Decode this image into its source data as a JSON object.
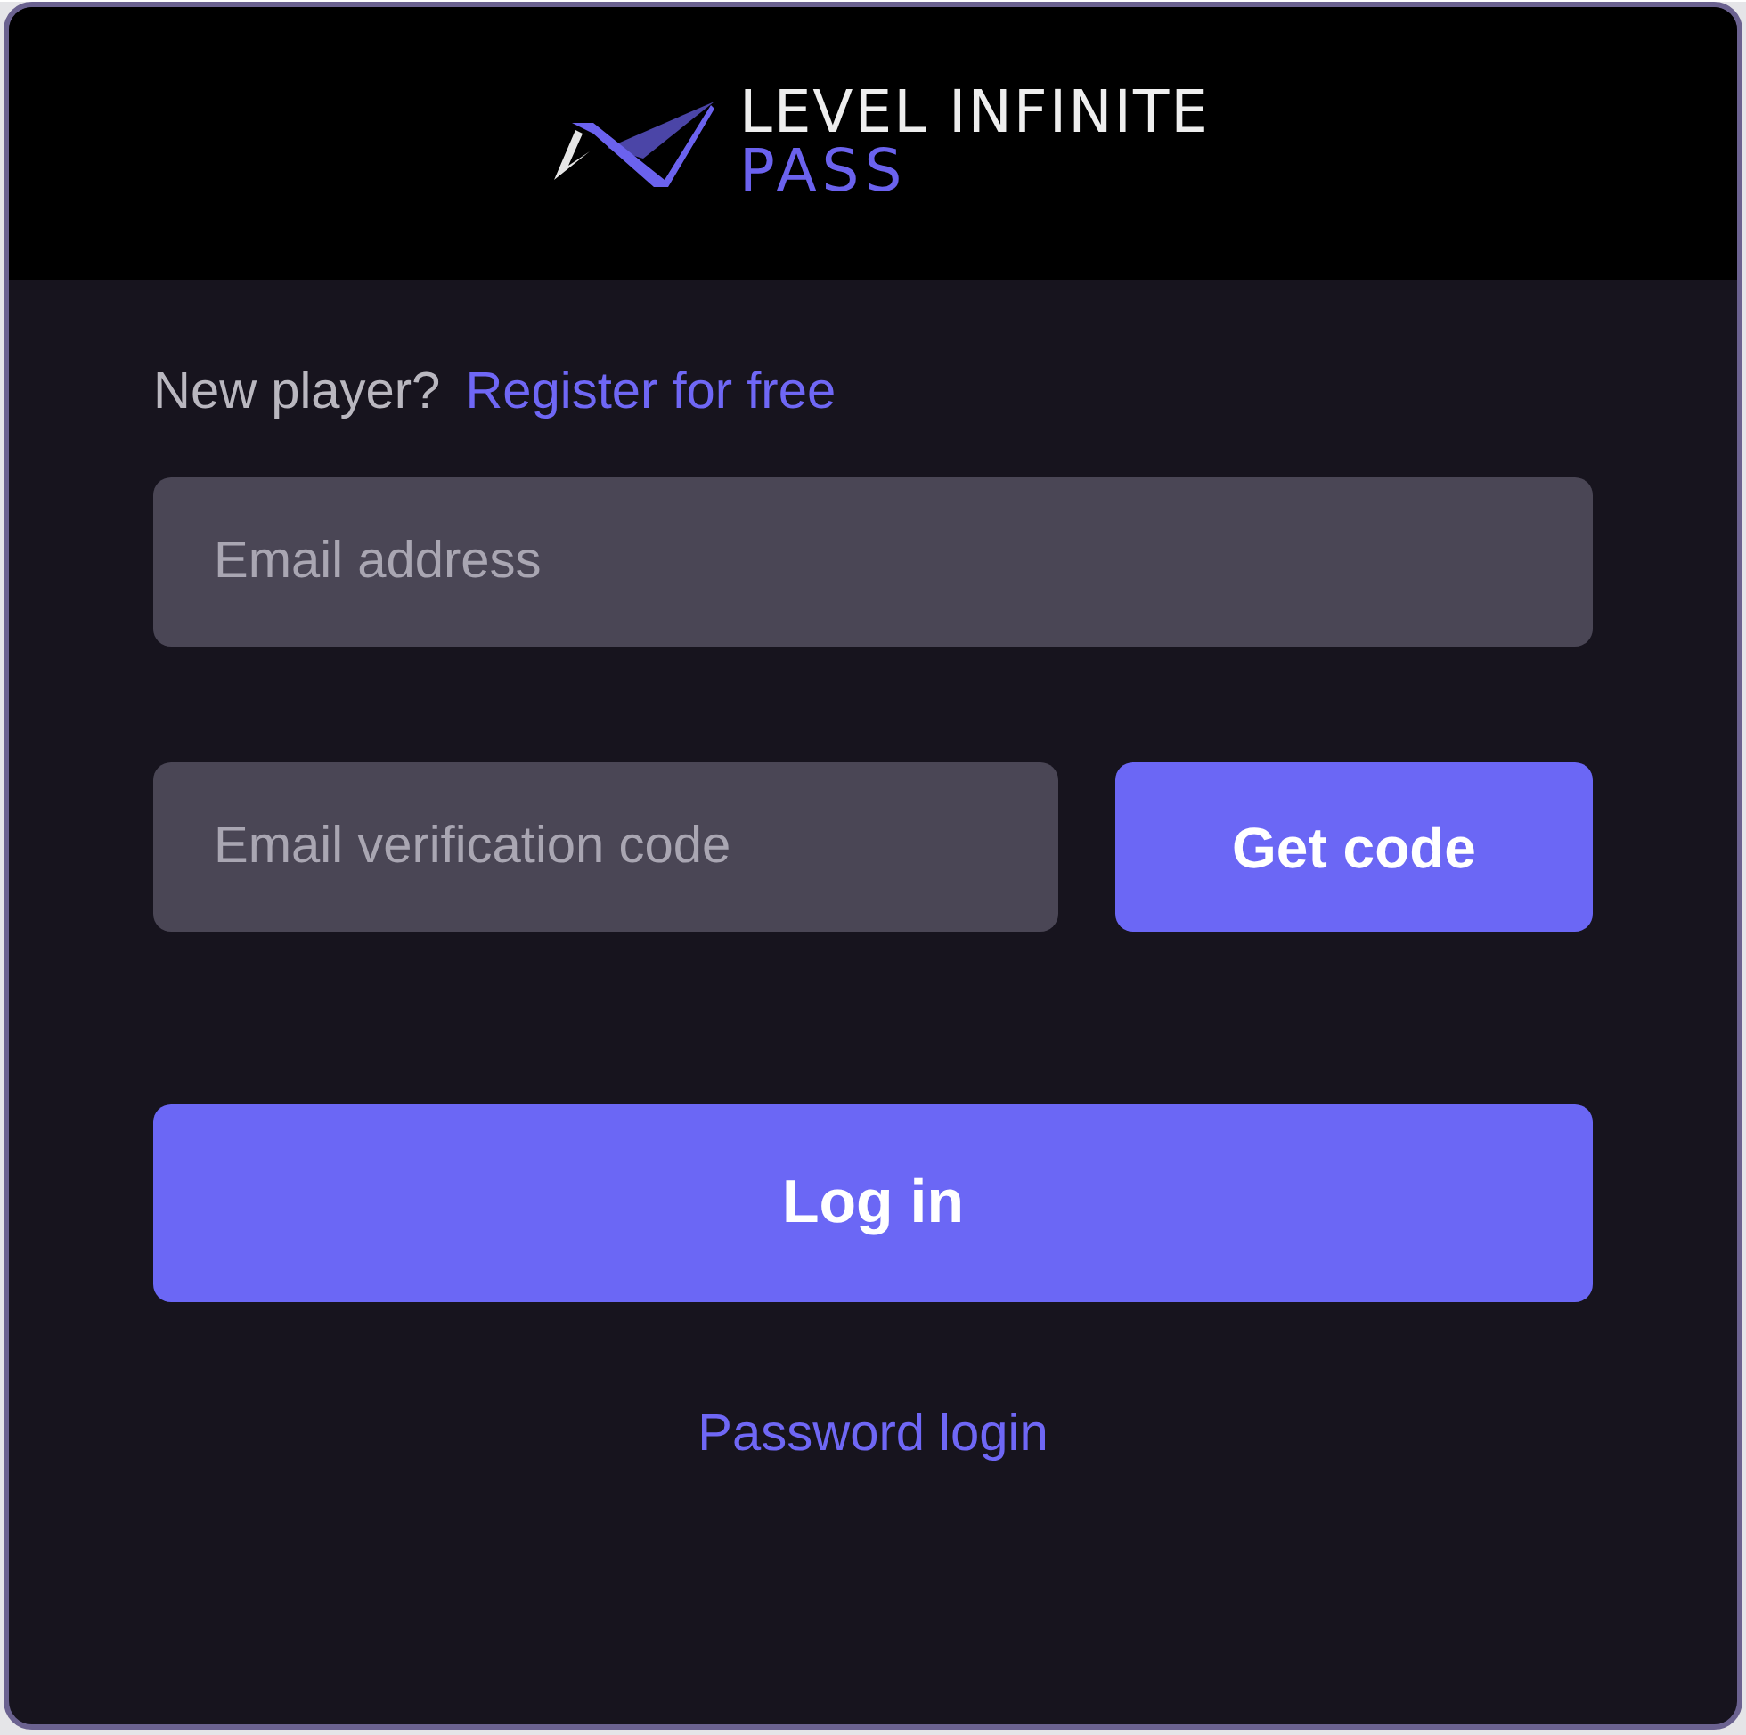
{
  "logo": {
    "line_1": "LEVEL INFINITE",
    "line_2": "PASS"
  },
  "register_prompt": {
    "question": "New player?",
    "link": "Register for free"
  },
  "email_field": {
    "placeholder": "Email address"
  },
  "code_field": {
    "placeholder": "Email verification code"
  },
  "get_code_button": "Get code",
  "login_button": "Log in",
  "password_login_link": "Password login"
}
